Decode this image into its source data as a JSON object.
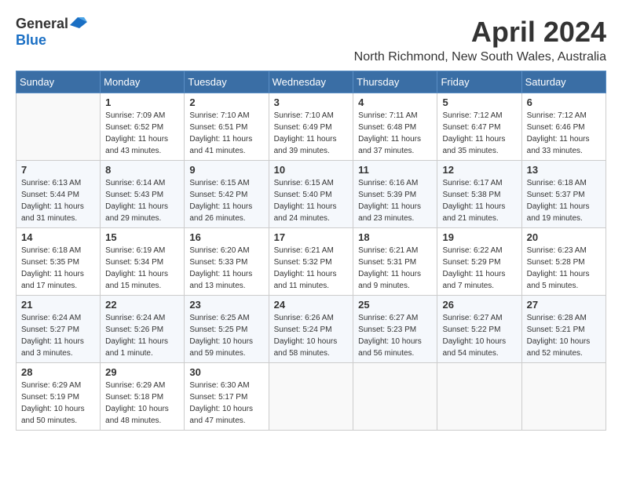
{
  "logo": {
    "general": "General",
    "blue": "Blue"
  },
  "title": "April 2024",
  "location": "North Richmond, New South Wales, Australia",
  "days_of_week": [
    "Sunday",
    "Monday",
    "Tuesday",
    "Wednesday",
    "Thursday",
    "Friday",
    "Saturday"
  ],
  "weeks": [
    [
      {
        "day": "",
        "info": ""
      },
      {
        "day": "1",
        "info": "Sunrise: 7:09 AM\nSunset: 6:52 PM\nDaylight: 11 hours\nand 43 minutes."
      },
      {
        "day": "2",
        "info": "Sunrise: 7:10 AM\nSunset: 6:51 PM\nDaylight: 11 hours\nand 41 minutes."
      },
      {
        "day": "3",
        "info": "Sunrise: 7:10 AM\nSunset: 6:49 PM\nDaylight: 11 hours\nand 39 minutes."
      },
      {
        "day": "4",
        "info": "Sunrise: 7:11 AM\nSunset: 6:48 PM\nDaylight: 11 hours\nand 37 minutes."
      },
      {
        "day": "5",
        "info": "Sunrise: 7:12 AM\nSunset: 6:47 PM\nDaylight: 11 hours\nand 35 minutes."
      },
      {
        "day": "6",
        "info": "Sunrise: 7:12 AM\nSunset: 6:46 PM\nDaylight: 11 hours\nand 33 minutes."
      }
    ],
    [
      {
        "day": "7",
        "info": "Sunrise: 6:13 AM\nSunset: 5:44 PM\nDaylight: 11 hours\nand 31 minutes."
      },
      {
        "day": "8",
        "info": "Sunrise: 6:14 AM\nSunset: 5:43 PM\nDaylight: 11 hours\nand 29 minutes."
      },
      {
        "day": "9",
        "info": "Sunrise: 6:15 AM\nSunset: 5:42 PM\nDaylight: 11 hours\nand 26 minutes."
      },
      {
        "day": "10",
        "info": "Sunrise: 6:15 AM\nSunset: 5:40 PM\nDaylight: 11 hours\nand 24 minutes."
      },
      {
        "day": "11",
        "info": "Sunrise: 6:16 AM\nSunset: 5:39 PM\nDaylight: 11 hours\nand 23 minutes."
      },
      {
        "day": "12",
        "info": "Sunrise: 6:17 AM\nSunset: 5:38 PM\nDaylight: 11 hours\nand 21 minutes."
      },
      {
        "day": "13",
        "info": "Sunrise: 6:18 AM\nSunset: 5:37 PM\nDaylight: 11 hours\nand 19 minutes."
      }
    ],
    [
      {
        "day": "14",
        "info": "Sunrise: 6:18 AM\nSunset: 5:35 PM\nDaylight: 11 hours\nand 17 minutes."
      },
      {
        "day": "15",
        "info": "Sunrise: 6:19 AM\nSunset: 5:34 PM\nDaylight: 11 hours\nand 15 minutes."
      },
      {
        "day": "16",
        "info": "Sunrise: 6:20 AM\nSunset: 5:33 PM\nDaylight: 11 hours\nand 13 minutes."
      },
      {
        "day": "17",
        "info": "Sunrise: 6:21 AM\nSunset: 5:32 PM\nDaylight: 11 hours\nand 11 minutes."
      },
      {
        "day": "18",
        "info": "Sunrise: 6:21 AM\nSunset: 5:31 PM\nDaylight: 11 hours\nand 9 minutes."
      },
      {
        "day": "19",
        "info": "Sunrise: 6:22 AM\nSunset: 5:29 PM\nDaylight: 11 hours\nand 7 minutes."
      },
      {
        "day": "20",
        "info": "Sunrise: 6:23 AM\nSunset: 5:28 PM\nDaylight: 11 hours\nand 5 minutes."
      }
    ],
    [
      {
        "day": "21",
        "info": "Sunrise: 6:24 AM\nSunset: 5:27 PM\nDaylight: 11 hours\nand 3 minutes."
      },
      {
        "day": "22",
        "info": "Sunrise: 6:24 AM\nSunset: 5:26 PM\nDaylight: 11 hours\nand 1 minute."
      },
      {
        "day": "23",
        "info": "Sunrise: 6:25 AM\nSunset: 5:25 PM\nDaylight: 10 hours\nand 59 minutes."
      },
      {
        "day": "24",
        "info": "Sunrise: 6:26 AM\nSunset: 5:24 PM\nDaylight: 10 hours\nand 58 minutes."
      },
      {
        "day": "25",
        "info": "Sunrise: 6:27 AM\nSunset: 5:23 PM\nDaylight: 10 hours\nand 56 minutes."
      },
      {
        "day": "26",
        "info": "Sunrise: 6:27 AM\nSunset: 5:22 PM\nDaylight: 10 hours\nand 54 minutes."
      },
      {
        "day": "27",
        "info": "Sunrise: 6:28 AM\nSunset: 5:21 PM\nDaylight: 10 hours\nand 52 minutes."
      }
    ],
    [
      {
        "day": "28",
        "info": "Sunrise: 6:29 AM\nSunset: 5:19 PM\nDaylight: 10 hours\nand 50 minutes."
      },
      {
        "day": "29",
        "info": "Sunrise: 6:29 AM\nSunset: 5:18 PM\nDaylight: 10 hours\nand 48 minutes."
      },
      {
        "day": "30",
        "info": "Sunrise: 6:30 AM\nSunset: 5:17 PM\nDaylight: 10 hours\nand 47 minutes."
      },
      {
        "day": "",
        "info": ""
      },
      {
        "day": "",
        "info": ""
      },
      {
        "day": "",
        "info": ""
      },
      {
        "day": "",
        "info": ""
      }
    ]
  ]
}
